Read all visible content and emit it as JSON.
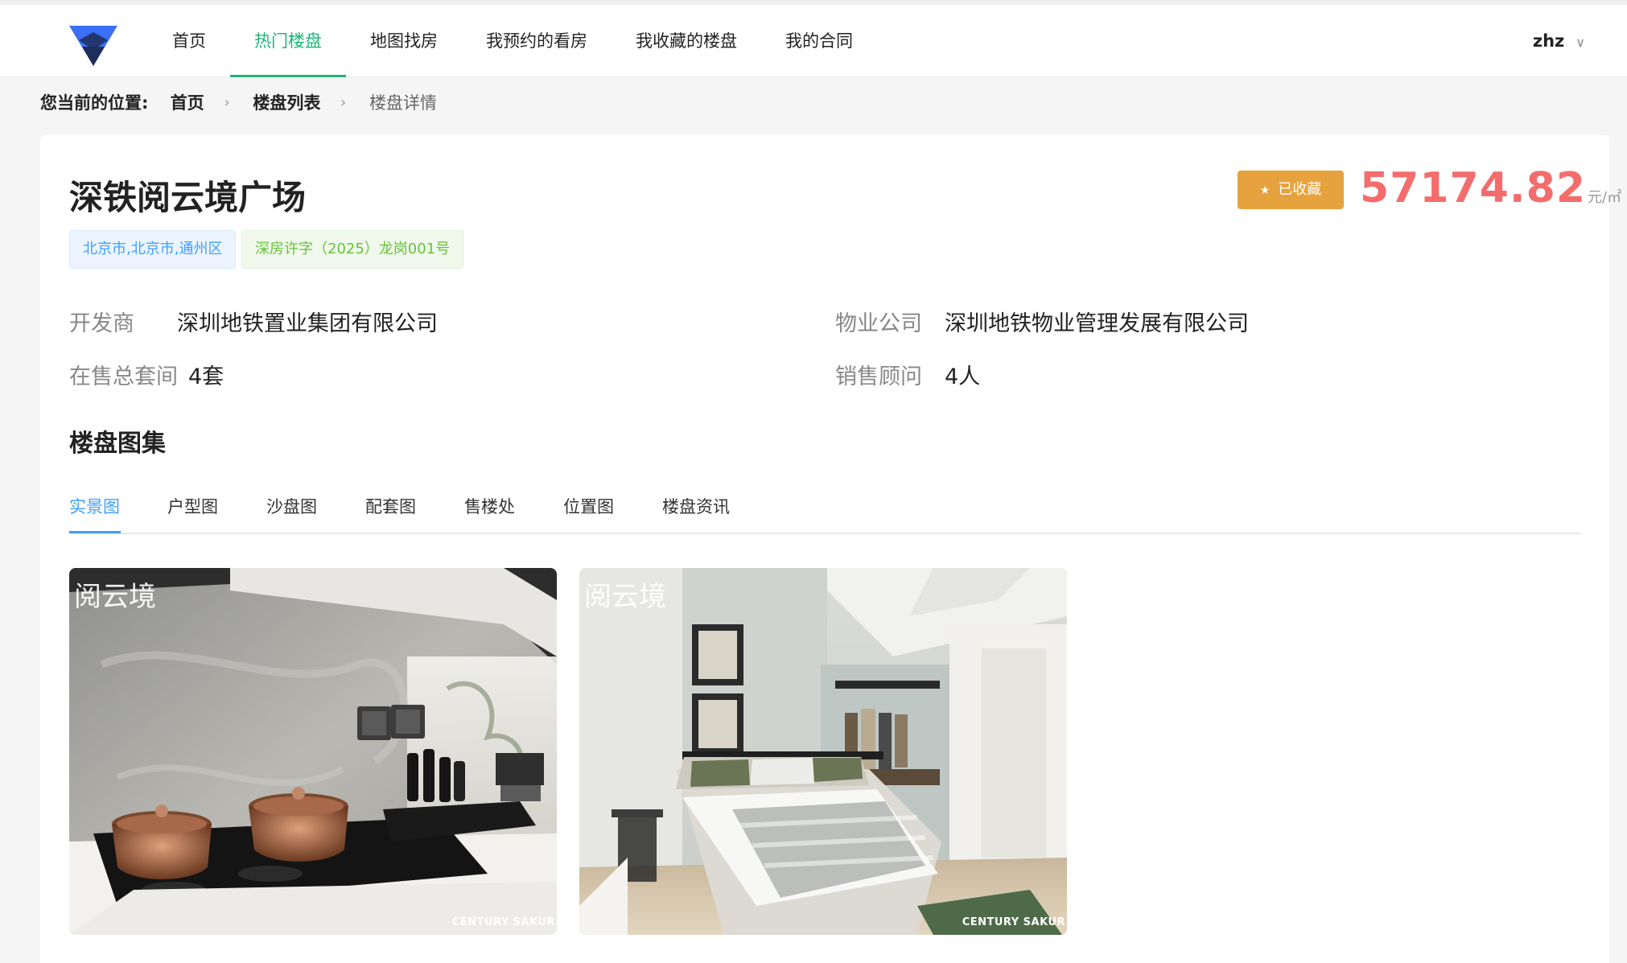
{
  "nav": {
    "items": [
      {
        "label": "首页",
        "active": false
      },
      {
        "label": "热门楼盘",
        "active": true
      },
      {
        "label": "地图找房",
        "active": false
      },
      {
        "label": "我预约的看房",
        "active": false
      },
      {
        "label": "我收藏的楼盘",
        "active": false
      },
      {
        "label": "我的合同",
        "active": false
      }
    ],
    "user": "zhz",
    "user_icon": "chevron-down-icon"
  },
  "breadcrumb": {
    "lead": "您当前的位置:",
    "items": [
      "首页",
      "楼盘列表",
      "楼盘详情"
    ]
  },
  "property": {
    "title": "深铁阅云境广场",
    "tags": [
      "北京市,北京市,通州区",
      "深房许字（2025）龙岗001号"
    ],
    "favorite_label": "已收藏",
    "price": "57174.82",
    "price_unit": "元/㎡",
    "info": {
      "developer_label": "开发商",
      "developer": "深圳地铁置业集团有限公司",
      "property_mgmt_label": "物业公司",
      "property_mgmt": "深圳地铁物业管理发展有限公司",
      "units_label": "在售总套间",
      "units": "4套",
      "advisors_label": "销售顾问",
      "advisors": "4人"
    }
  },
  "gallery": {
    "title": "楼盘图集",
    "tabs": [
      "实景图",
      "户型图",
      "沙盘图",
      "配套图",
      "售楼处",
      "位置图",
      "楼盘资讯"
    ],
    "active_tab": 0,
    "photos": [
      {
        "subject": "kitchen",
        "watermark": "阅云境",
        "brand": "CENTURY SAKUR"
      },
      {
        "subject": "bedroom",
        "watermark": "阅云境",
        "brand": "CENTURY SAKUR"
      }
    ]
  },
  "colors": {
    "accent_green": "#1fb57a",
    "accent_blue": "#409eff",
    "price_red": "#f56c6c",
    "favorite_orange": "#e6a23c"
  }
}
